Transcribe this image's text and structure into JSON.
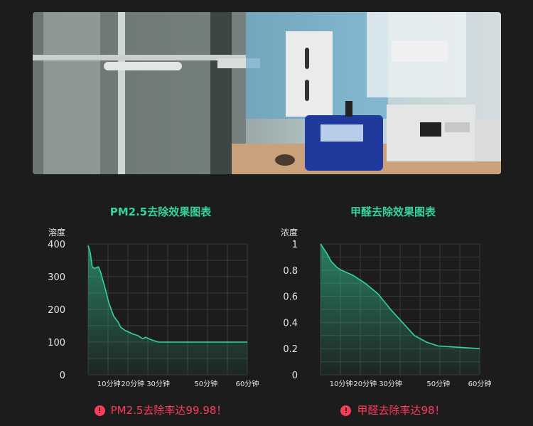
{
  "photo": {
    "subject": "lab-test-setup"
  },
  "charts": [
    {
      "title": "PM2.5去除效果图表",
      "ylabel": "溶度",
      "y_ticks": [
        "0",
        "100",
        "200",
        "300",
        "400"
      ],
      "x_ticks": [
        "10分钟",
        "20分钟",
        "30分钟",
        "50分钟",
        "60分钟"
      ],
      "result": "PM2.5去除率达99.98！"
    },
    {
      "title": "甲醛去除效果图表",
      "ylabel": "浓度",
      "y_ticks": [
        "0",
        "0.2",
        "0.4",
        "0.6",
        "0.8",
        "1"
      ],
      "x_ticks": [
        "10分钟",
        "20分钟",
        "30分钟",
        "50分钟",
        "60分钟"
      ],
      "result": "甲醛去除率达98！"
    }
  ],
  "chart_data": [
    {
      "type": "area",
      "title": "PM2.5去除效果图表",
      "ylabel": "溶度",
      "xlabel": "",
      "x": [
        0,
        1,
        2,
        3,
        5,
        6,
        8,
        10,
        12,
        14,
        15,
        17,
        20,
        22,
        24,
        25,
        27,
        30,
        40,
        50,
        60
      ],
      "y": [
        395,
        375,
        330,
        325,
        330,
        315,
        270,
        220,
        180,
        160,
        145,
        135,
        125,
        120,
        110,
        115,
        108,
        100,
        100,
        100,
        100
      ],
      "ylim": [
        0,
        400
      ],
      "grid": true,
      "color": "#34d399"
    },
    {
      "type": "area",
      "title": "甲醛去除效果图表",
      "ylabel": "浓度",
      "xlabel": "",
      "x": [
        0,
        3,
        5,
        8,
        10,
        15,
        20,
        25,
        30,
        35,
        40,
        45,
        50,
        55,
        60
      ],
      "y": [
        1.0,
        0.93,
        0.87,
        0.82,
        0.8,
        0.76,
        0.7,
        0.62,
        0.5,
        0.4,
        0.3,
        0.25,
        0.22,
        0.21,
        0.2
      ],
      "ylim": [
        0,
        1
      ],
      "grid": true,
      "color": "#34d399"
    }
  ]
}
